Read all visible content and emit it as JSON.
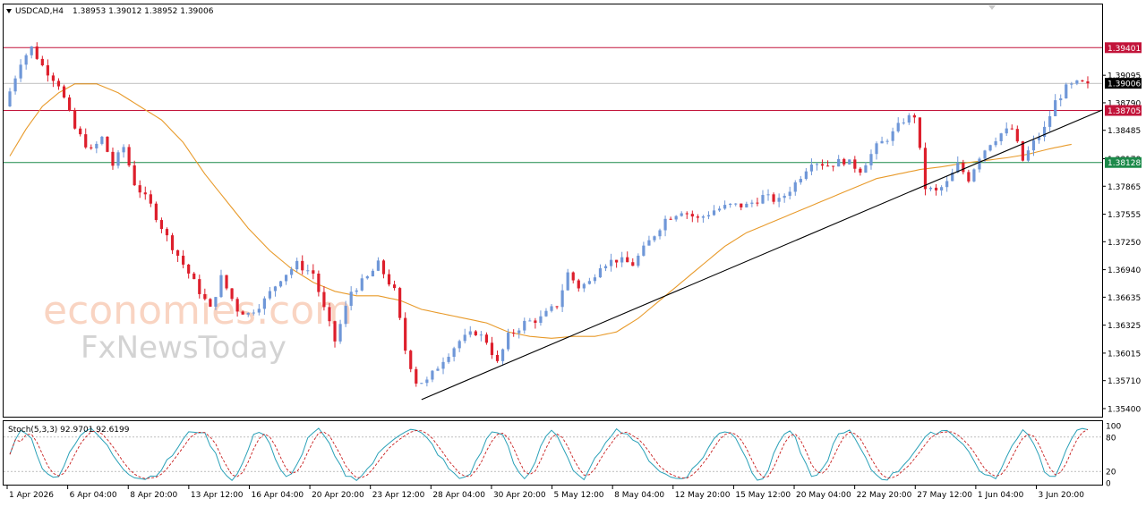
{
  "header": {
    "symbol": "USDCAD,H4",
    "ohlc": "1.38953 1.39012 1.38952 1.39006"
  },
  "stoch": {
    "label": "Stoch(5,3,3) 92.9701 92.6199"
  },
  "watermark": {
    "line1": "economies.com",
    "line2": "FxNewsToday"
  },
  "colors": {
    "bull": "#6f97d8",
    "bear": "#dd1f2c",
    "ma": "#e89a2a",
    "resistance": "#c2143a",
    "support": "#1c8a4a",
    "trend": "#000000",
    "stoch_main": "#2aa1b8",
    "stoch_signal": "#c81e1e"
  },
  "chart_data": [
    {
      "type": "candlestick",
      "title": "USDCAD,H4",
      "ylim": [
        1.3535,
        1.3985
      ],
      "y_ticks": [
        "1.39095",
        "1.38790",
        "1.38485",
        "1.38170",
        "1.37865",
        "1.37555",
        "1.37250",
        "1.36940",
        "1.36635",
        "1.36325",
        "1.36015",
        "1.35710",
        "1.35400"
      ],
      "x_labels": [
        "1 Apr 2026",
        "6 Apr 04:00",
        "8 Apr 20:00",
        "13 Apr 12:00",
        "16 Apr 04:00",
        "20 Apr 20:00",
        "23 Apr 12:00",
        "28 Apr 04:00",
        "30 Apr 20:00",
        "5 May 12:00",
        "8 May 04:00",
        "12 May 20:00",
        "15 May 12:00",
        "20 May 04:00",
        "22 May 20:00",
        "27 May 12:00",
        "1 Jun 04:00",
        "3 Jun 20:00"
      ],
      "close_path": [
        [
          0,
          1.3875
        ],
        [
          3,
          1.3925
        ],
        [
          5,
          1.394
        ],
        [
          7,
          1.392
        ],
        [
          10,
          1.39
        ],
        [
          13,
          1.385
        ],
        [
          16,
          1.3825
        ],
        [
          18,
          1.384
        ],
        [
          20,
          1.381
        ],
        [
          22,
          1.383
        ],
        [
          24,
          1.379
        ],
        [
          27,
          1.3765
        ],
        [
          30,
          1.373
        ],
        [
          33,
          1.37
        ],
        [
          36,
          1.367
        ],
        [
          38,
          1.365
        ],
        [
          40,
          1.3685
        ],
        [
          43,
          1.365
        ],
        [
          45,
          1.3645
        ],
        [
          48,
          1.366
        ],
        [
          51,
          1.3685
        ],
        [
          54,
          1.37
        ],
        [
          57,
          1.369
        ],
        [
          59,
          1.365
        ],
        [
          61,
          1.3615
        ],
        [
          64,
          1.367
        ],
        [
          67,
          1.3685
        ],
        [
          69,
          1.37
        ],
        [
          72,
          1.367
        ],
        [
          74,
          1.3605
        ],
        [
          76,
          1.357
        ],
        [
          78,
          1.357
        ],
        [
          81,
          1.3595
        ],
        [
          84,
          1.3615
        ],
        [
          87,
          1.3625
        ],
        [
          89,
          1.3615
        ],
        [
          91,
          1.359
        ],
        [
          93,
          1.362
        ],
        [
          96,
          1.3635
        ],
        [
          99,
          1.364
        ],
        [
          102,
          1.3655
        ],
        [
          104,
          1.369
        ],
        [
          106,
          1.3675
        ],
        [
          108,
          1.368
        ],
        [
          110,
          1.37
        ],
        [
          113,
          1.3705
        ],
        [
          116,
          1.37
        ],
        [
          119,
          1.3725
        ],
        [
          122,
          1.375
        ],
        [
          125,
          1.376
        ],
        [
          128,
          1.375
        ],
        [
          131,
          1.376
        ],
        [
          134,
          1.3765
        ],
        [
          137,
          1.3765
        ],
        [
          140,
          1.3775
        ],
        [
          143,
          1.377
        ],
        [
          146,
          1.379
        ],
        [
          149,
          1.3815
        ],
        [
          152,
          1.381
        ],
        [
          155,
          1.3815
        ],
        [
          158,
          1.3805
        ],
        [
          161,
          1.383
        ],
        [
          164,
          1.3845
        ],
        [
          166,
          1.386
        ],
        [
          168,
          1.3865
        ],
        [
          170,
          1.3785
        ],
        [
          172,
          1.378
        ],
        [
          174,
          1.379
        ],
        [
          176,
          1.381
        ],
        [
          178,
          1.3795
        ],
        [
          180,
          1.382
        ],
        [
          182,
          1.3835
        ],
        [
          184,
          1.3845
        ],
        [
          186,
          1.385
        ],
        [
          188,
          1.3815
        ],
        [
          190,
          1.3835
        ],
        [
          192,
          1.385
        ],
        [
          194,
          1.388
        ],
        [
          196,
          1.3895
        ],
        [
          198,
          1.39
        ]
      ],
      "ma_path": [
        [
          0,
          1.382
        ],
        [
          3,
          1.385
        ],
        [
          6,
          1.3875
        ],
        [
          9,
          1.389
        ],
        [
          12,
          1.39
        ],
        [
          16,
          1.39
        ],
        [
          20,
          1.389
        ],
        [
          24,
          1.3875
        ],
        [
          28,
          1.386
        ],
        [
          32,
          1.3835
        ],
        [
          36,
          1.38
        ],
        [
          40,
          1.377
        ],
        [
          44,
          1.374
        ],
        [
          48,
          1.3715
        ],
        [
          52,
          1.3695
        ],
        [
          56,
          1.368
        ],
        [
          60,
          1.367
        ],
        [
          64,
          1.3665
        ],
        [
          68,
          1.3665
        ],
        [
          72,
          1.366
        ],
        [
          76,
          1.365
        ],
        [
          80,
          1.3645
        ],
        [
          84,
          1.364
        ],
        [
          88,
          1.3635
        ],
        [
          92,
          1.3625
        ],
        [
          96,
          1.362
        ],
        [
          100,
          1.3618
        ],
        [
          104,
          1.362
        ],
        [
          108,
          1.362
        ],
        [
          112,
          1.3625
        ],
        [
          116,
          1.364
        ],
        [
          120,
          1.366
        ],
        [
          124,
          1.368
        ],
        [
          128,
          1.37
        ],
        [
          132,
          1.372
        ],
        [
          136,
          1.3735
        ],
        [
          140,
          1.3745
        ],
        [
          144,
          1.3755
        ],
        [
          148,
          1.3765
        ],
        [
          152,
          1.3775
        ],
        [
          156,
          1.3785
        ],
        [
          160,
          1.3795
        ],
        [
          164,
          1.38
        ],
        [
          168,
          1.3805
        ],
        [
          172,
          1.3808
        ],
        [
          176,
          1.3812
        ],
        [
          180,
          1.3815
        ],
        [
          184,
          1.3818
        ],
        [
          188,
          1.3822
        ],
        [
          192,
          1.3828
        ],
        [
          196,
          1.3833
        ]
      ],
      "horizontal_levels": [
        {
          "label": "1.39401",
          "kind": "resistance"
        },
        {
          "label": "1.39006",
          "kind": "current"
        },
        {
          "label": "1.38705",
          "kind": "resistance"
        },
        {
          "label": "1.38128",
          "kind": "support"
        }
      ],
      "trendline": [
        [
          76,
          1.355
        ],
        [
          198,
          1.3865
        ]
      ]
    },
    {
      "type": "line",
      "title": "Stoch(5,3,3) 92.9701 92.6199",
      "ylim": [
        0,
        100
      ],
      "y_ticks": [
        "100",
        "80",
        "20",
        "0"
      ],
      "reference_levels": [
        80,
        20
      ],
      "series": [
        {
          "name": "Stoch(5,3,3)",
          "values_note": "oscillator main line"
        },
        {
          "name": "Signal",
          "values_note": "dashed signal line"
        }
      ]
    }
  ]
}
